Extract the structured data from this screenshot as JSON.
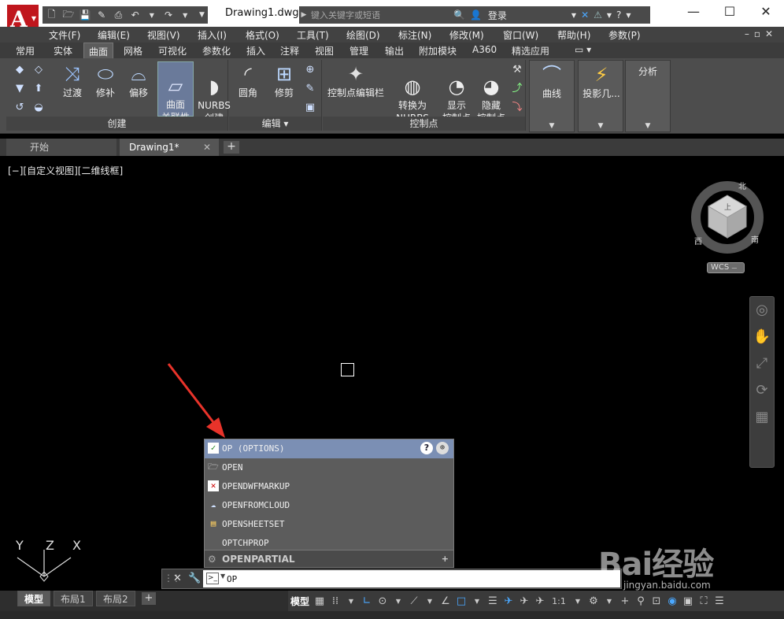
{
  "title_bar": {
    "app_button": "A",
    "document_title": "Drawing1.dwg",
    "search_placeholder": "键入关键字或短语",
    "login_label": "登录",
    "window_controls": [
      "—",
      "☐",
      "✕"
    ]
  },
  "menu_bar": {
    "items": [
      "文件(F)",
      "编辑(E)",
      "视图(V)",
      "插入(I)",
      "格式(O)",
      "工具(T)",
      "绘图(D)",
      "标注(N)",
      "修改(M)",
      "窗口(W)",
      "帮助(H)",
      "参数(P)"
    ]
  },
  "ribbon_tabs": {
    "items": [
      "常用",
      "实体",
      "曲面",
      "网格",
      "可视化",
      "参数化",
      "插入",
      "注释",
      "视图",
      "管理",
      "输出",
      "附加模块",
      "A360",
      "精选应用"
    ],
    "active": "曲面"
  },
  "ribbon": {
    "groups": {
      "create": {
        "title": "创建",
        "buttons": [
          "过渡",
          "修补",
          "偏移",
          "曲面\n关联性",
          "NURBS\n创建"
        ]
      },
      "edit": {
        "title": "编辑",
        "buttons": [
          "圆角",
          "修剪"
        ]
      },
      "control_points": {
        "title": "控制点",
        "buttons": [
          "控制点编辑栏",
          "转换为\nNURBS",
          "显示\n控制点",
          "隐藏\n控制点"
        ]
      },
      "curves": {
        "button": "曲线"
      },
      "project": {
        "button": "投影几..."
      },
      "analysis": {
        "button": "分析"
      }
    }
  },
  "file_tabs": {
    "items": [
      {
        "label": "开始"
      },
      {
        "label": "Drawing1*"
      }
    ]
  },
  "canvas": {
    "view_label": "[−][自定义视图][二维线框]",
    "viewcube": {
      "top_face": "上",
      "compass": {
        "north": "北",
        "west": "西",
        "south": "南"
      },
      "wcs_label": "WCS"
    },
    "ucs": {
      "y": "Y",
      "z": "Z",
      "x": "X"
    }
  },
  "autocomplete": {
    "items": [
      {
        "label": "OP (OPTIONS)",
        "selected": true
      },
      {
        "label": "OPEN"
      },
      {
        "label": "OPENDWFMARKUP"
      },
      {
        "label": "OPENFROMCLOUD"
      },
      {
        "label": "OPENSHEETSET"
      },
      {
        "label": "OPTCHPROP"
      }
    ],
    "partial": "OPENPARTIAL",
    "help_icon": "?"
  },
  "command_line": {
    "value": "OP"
  },
  "status_bar": {
    "layout_tabs": [
      "模型",
      "布局1",
      "布局2"
    ],
    "model_label": "模型",
    "scale": "1:1"
  },
  "watermark": {
    "text": "Bai经验",
    "url": "jingyan.baidu.com"
  },
  "colors": {
    "app_red": "#c0161d",
    "selected_row": "#7b8fb4",
    "arrow": "#e8332a"
  }
}
